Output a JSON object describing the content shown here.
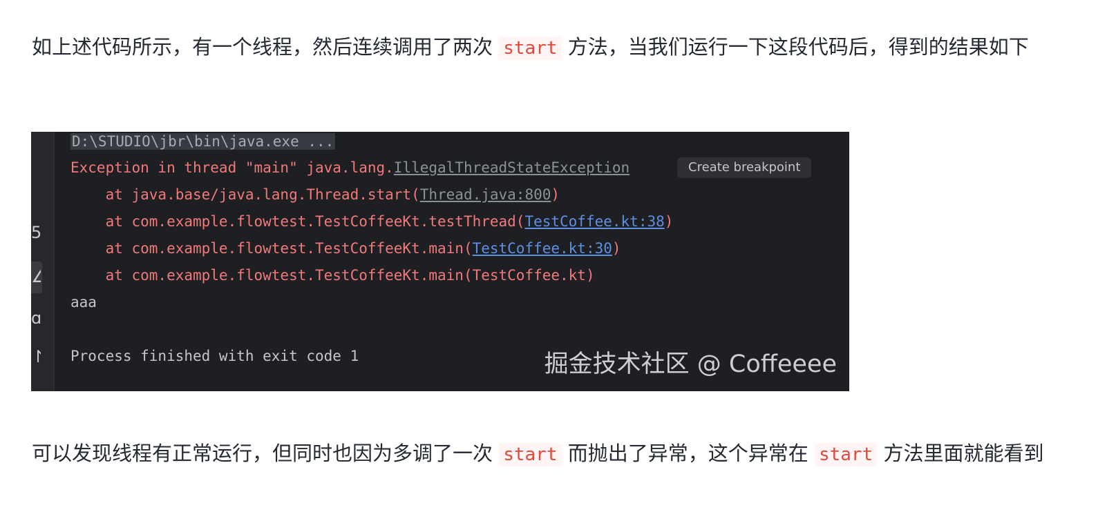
{
  "paragraph1": {
    "before": "如上述代码所示，有一个线程，然后连续调用了两次",
    "code": "start",
    "after": "方法，当我们运行一下这段代码后，得到的结果如下"
  },
  "console": {
    "command": "D:\\STUDIO\\jbr\\bin\\java.exe ...",
    "exception_prefix": "Exception in thread \"main\" java.lang.",
    "exception_class": "IllegalThreadStateException",
    "tooltip": "Create breakpoint",
    "frames": [
      {
        "prefix": "    at java.base/java.lang.Thread.start(",
        "link": "Thread.java:800",
        "suffix": ")"
      },
      {
        "prefix": "    at com.example.flowtest.TestCoffeeKt.testThread(",
        "link": "TestCoffee.kt:38",
        "suffix": ")"
      },
      {
        "prefix": "    at com.example.flowtest.TestCoffeeKt.main(",
        "link": "TestCoffee.kt:30",
        "suffix": ")"
      },
      {
        "text": "    at com.example.flowtest.TestCoffeeKt.main(TestCoffee.kt)"
      }
    ],
    "output": "aaa",
    "exit_message": "Process finished with exit code 1",
    "watermark": "掘金技术社区 @ Coffeeee"
  },
  "paragraph2": {
    "part1": "可以发现线程有正常运行，但同时也因为多调了一次",
    "code1": "start",
    "part2": "而抛出了异常，这个异常在",
    "code2": "start",
    "part3": "方法里面就能看到"
  },
  "colors": {
    "inline_code": "#e5483b",
    "console_bg": "#1e1f22",
    "error_text": "#f2797a",
    "link": "#5e8fe4"
  }
}
